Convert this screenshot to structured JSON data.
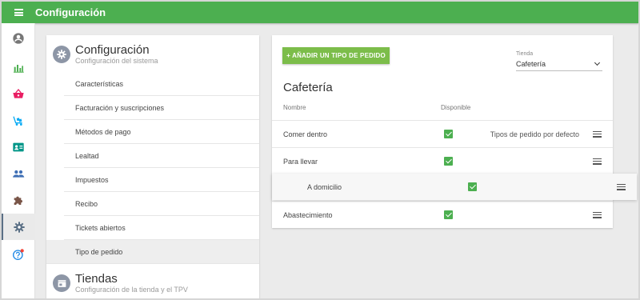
{
  "app": {
    "title": "Configuración"
  },
  "sidebar": {
    "items": [
      {
        "icon": "account-circle-icon",
        "color": "#777777"
      },
      {
        "icon": "bar-chart-icon",
        "color": "#4caf50"
      },
      {
        "icon": "basket-icon",
        "color": "#e91e63"
      },
      {
        "icon": "cart-icon",
        "color": "#03a9f4"
      },
      {
        "icon": "contact-card-icon",
        "color": "#009688"
      },
      {
        "icon": "people-icon",
        "color": "#3f6fb5"
      },
      {
        "icon": "puzzle-icon",
        "color": "#795548"
      },
      {
        "icon": "gear-icon",
        "color": "#5a6f85",
        "active": true
      },
      {
        "icon": "help-icon",
        "color": "#1e88e5",
        "badge_color": "#f44336"
      }
    ]
  },
  "settings_panel": {
    "config_section": {
      "title": "Configuración",
      "subtitle": "Configuración del sistema"
    },
    "menu": [
      "Características",
      "Facturación y suscripciones",
      "Métodos de pago",
      "Lealtad",
      "Impuestos",
      "Recibo",
      "Tickets abiertos",
      "Tipo de pedido"
    ],
    "active_menu_index": 7,
    "stores_section": {
      "title": "Tiendas",
      "subtitle": "Configuración de la tienda y el TPV"
    }
  },
  "order_types": {
    "add_button": "+ AÑADIR UN TIPO DE PEDIDO",
    "store_select": {
      "label": "Tienda",
      "value": "Cafetería"
    },
    "heading": "Cafetería",
    "columns": {
      "name": "Nombre",
      "available": "Disponible"
    },
    "rows": [
      {
        "name": "Comer dentro",
        "available": true,
        "note": "Tipos de pedido por defecto"
      },
      {
        "name": "Para llevar",
        "available": true,
        "note": ""
      },
      {
        "name": "A domicilio",
        "available": true,
        "note": "",
        "dragging": true
      },
      {
        "name": "Abastecimiento",
        "available": true,
        "note": ""
      }
    ]
  },
  "colors": {
    "topbar": "#4caf50",
    "button": "#7cbd4a",
    "checkbox": "#4caf50"
  }
}
